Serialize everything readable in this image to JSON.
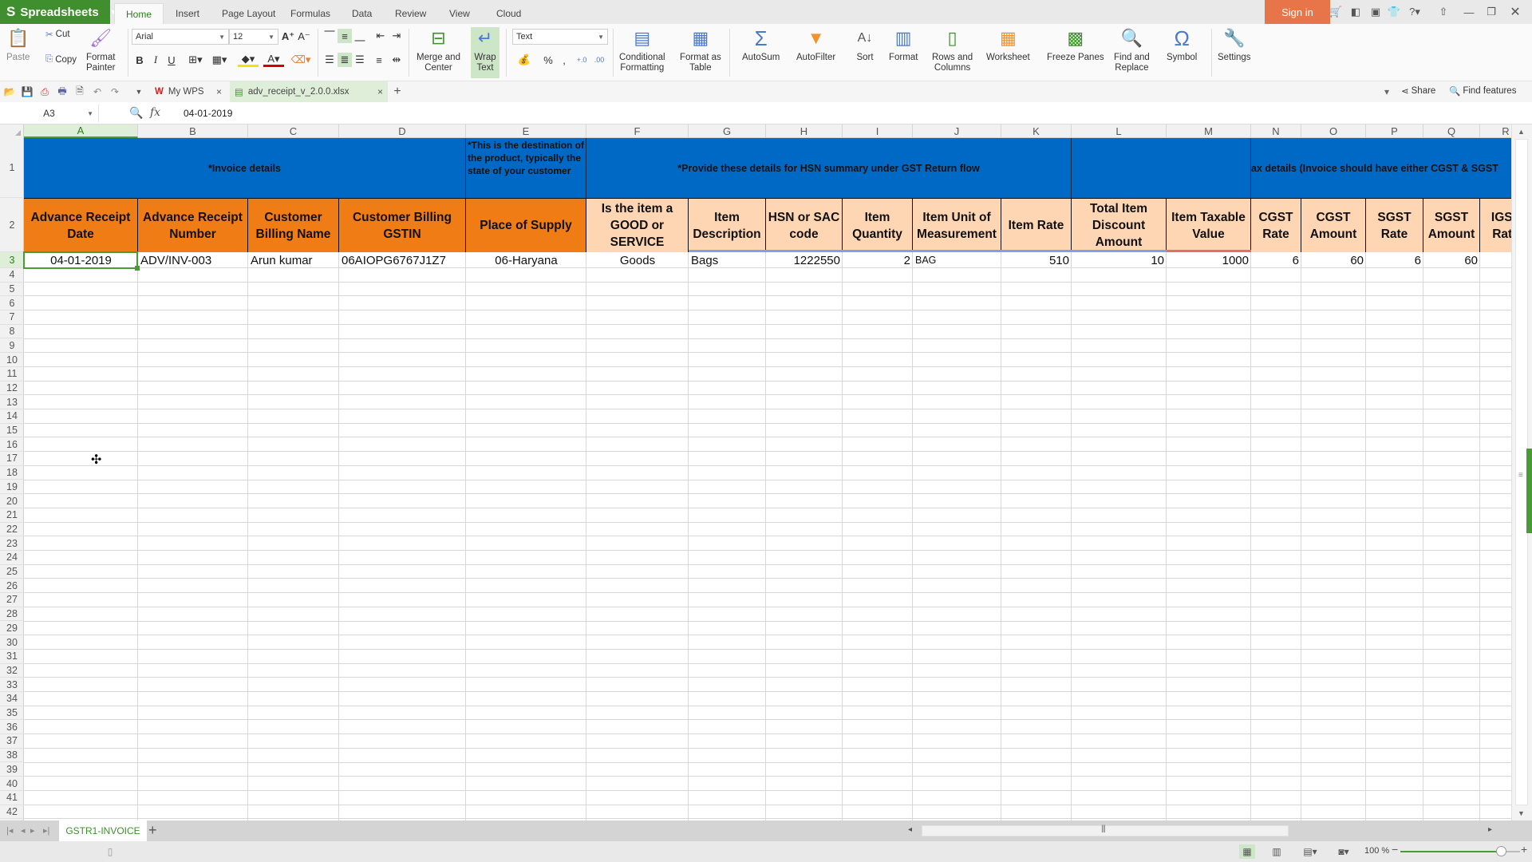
{
  "app": {
    "name": "Spreadsheets",
    "menu_tabs": [
      "Home",
      "Insert",
      "Page Layout",
      "Formulas",
      "Data",
      "Review",
      "View",
      "Cloud"
    ],
    "active_tab": "Home",
    "sign_in": "Sign in"
  },
  "ribbon": {
    "paste": "Paste",
    "cut": "Cut",
    "copy": "Copy",
    "format_painter": "Format\nPainter",
    "font_name": "Arial",
    "font_size": "12",
    "merge_center": "Merge and\nCenter",
    "wrap_text": "Wrap\nText",
    "number_format": "Text",
    "conditional_formatting": "Conditional\nFormatting",
    "format_as_table": "Format as\nTable",
    "autosum": "AutoSum",
    "autofilter": "AutoFilter",
    "sort": "Sort",
    "format": "Format",
    "rows_columns": "Rows and\nColumns",
    "worksheet": "Worksheet",
    "freeze_panes": "Freeze Panes",
    "find_replace": "Find and\nReplace",
    "symbol": "Symbol",
    "settings": "Settings"
  },
  "doc_tabs": [
    {
      "label": "My WPS",
      "active": false
    },
    {
      "label": "adv_receipt_v_2.0.0.xlsx",
      "active": true
    }
  ],
  "right_tools": {
    "share": "Share",
    "find_features": "Find features"
  },
  "formula_bar": {
    "name_box": "A3",
    "content": "04-01-2019"
  },
  "columns": [
    "A",
    "B",
    "C",
    "D",
    "E",
    "F",
    "G",
    "H",
    "I",
    "J",
    "K",
    "L",
    "M",
    "N",
    "O",
    "P",
    "Q",
    "R"
  ],
  "selected_column": "A",
  "selected_row": 3,
  "row_numbers": [
    1,
    2,
    3,
    4,
    5,
    6,
    7,
    8,
    9,
    10,
    11,
    12,
    13,
    14,
    15,
    16,
    17,
    18,
    19,
    20,
    21,
    22,
    23,
    24,
    25,
    26,
    27,
    28,
    29,
    30,
    31,
    32,
    33,
    34,
    35,
    36,
    37,
    38,
    39,
    40,
    41,
    42
  ],
  "bands": [
    {
      "text": "*Invoice details",
      "span": "A-D"
    },
    {
      "text": "*This is the destination of the product, typically the state of your customer",
      "span": "E"
    },
    {
      "text": "*Provide these details for HSN summary under GST Return flow",
      "span": "F-K"
    },
    {
      "text": "",
      "span": "L-M"
    },
    {
      "text": "ax details (Invoice should have either CGST & SGST",
      "span": "N-R"
    }
  ],
  "headers": [
    "Advance Receipt Date",
    "Advance Receipt Number",
    "Customer Billing Name",
    "Customer Billing GSTIN",
    "Place of Supply",
    "Is the item a GOOD or SERVICE",
    "Item Description",
    "HSN or SAC code",
    "Item Quantity",
    "Item Unit of Measurement",
    "Item Rate",
    "Total Item Discount Amount",
    "Item Taxable Value",
    "CGST Rate",
    "CGST Amount",
    "SGST Rate",
    "SGST Amount",
    "IGST Rate"
  ],
  "rows": [
    [
      "04-01-2019",
      "ADV/INV-003",
      "Arun kumar",
      "06AIOPG6767J1Z7",
      "06-Haryana",
      "Goods",
      "Bags",
      "1222550",
      "2",
      "BAG",
      "510",
      "10",
      "1000",
      "6",
      "60",
      "6",
      "60",
      ""
    ]
  ],
  "sheet_tabs": [
    "GSTR1-INVOICE"
  ],
  "status": {
    "zoom": "100 %",
    "zoom_percent": 100
  },
  "colors": {
    "accent": "#3f8f2e",
    "band_blue": "#0069c6",
    "header_orange": "#f07c16",
    "header_peach": "#ffd6b3",
    "sign_in": "#e8754a"
  }
}
